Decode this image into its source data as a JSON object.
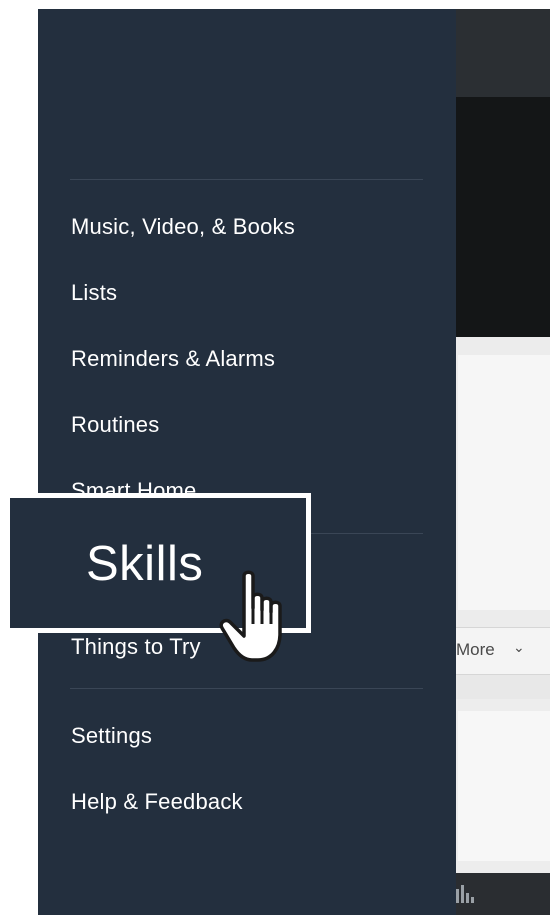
{
  "background": {
    "more_label": "More",
    "more_chevron": "chevron-down-icon"
  },
  "drawer": {
    "items": [
      {
        "label": "Music, Video, & Books"
      },
      {
        "label": "Lists"
      },
      {
        "label": "Reminders & Alarms"
      },
      {
        "label": "Routines"
      },
      {
        "label": "Smart Home"
      },
      {
        "label": "Things to Try"
      },
      {
        "label": "Settings"
      },
      {
        "label": "Help & Feedback"
      }
    ]
  },
  "callout": {
    "label": "Skills",
    "cursor_icon": "hand-pointer-icon"
  },
  "colors": {
    "drawer_bg": "#232f3e",
    "text": "#ffffff",
    "divider": "#3a4656"
  }
}
